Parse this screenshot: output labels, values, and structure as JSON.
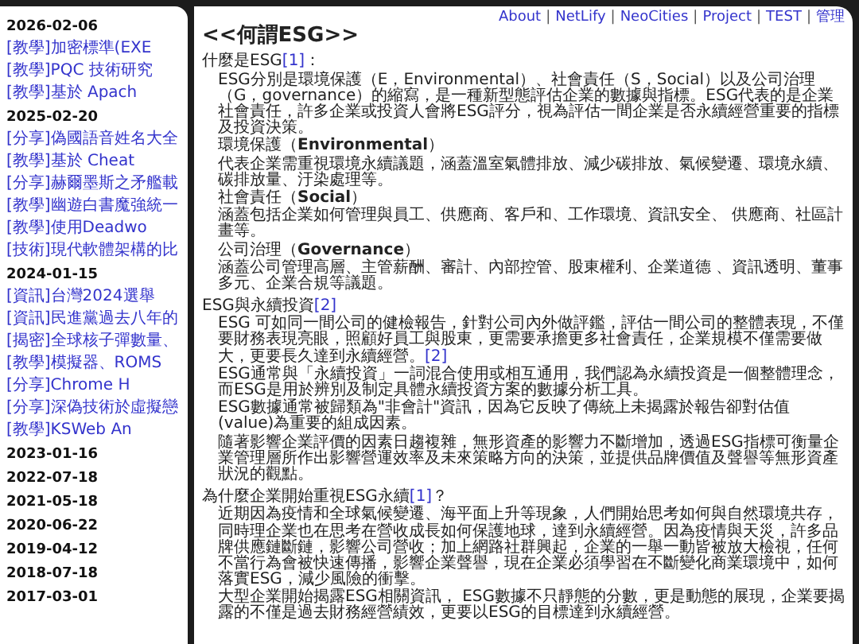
{
  "sidebar": {
    "groups": [
      {
        "date": "2026-02-06",
        "posts": [
          "[教學]加密標準(EXE",
          "[教學]PQC 技術研究",
          "[教學]基於 Apach"
        ]
      },
      {
        "date": "2025-02-20",
        "posts": [
          "[分享]偽國語音姓名大全",
          "[教學]基於 Cheat",
          "[分享]赫爾墨斯之矛艦載",
          "[教學]幽遊白書魔強統一",
          "[教學]使用Deadwo",
          "[技術]現代軟體架構的比"
        ]
      },
      {
        "date": "2024-01-15",
        "posts": [
          "[資訊]台灣2024選舉",
          "[資訊]民進黨過去八年的",
          "[揭密]全球核子彈數量、",
          "[教學]模擬器、ROMS",
          "[分享]Chrome H",
          "[分享]深偽技術於虛擬戀",
          "[教學]KSWeb An"
        ]
      },
      {
        "date": "2023-01-16"
      },
      {
        "date": "2022-07-18"
      },
      {
        "date": "2021-05-18"
      },
      {
        "date": "2020-06-22"
      },
      {
        "date": "2019-04-12"
      },
      {
        "date": "2018-07-18"
      },
      {
        "date": "2017-03-01"
      }
    ]
  },
  "nav": {
    "links": [
      "About",
      "NetLify",
      "NeoCities",
      "Project",
      "TEST",
      "管理"
    ],
    "separator": "|"
  },
  "title": "<<何謂ESG>>",
  "sections": [
    {
      "heading": "什麼是ESG",
      "ref": "[1]",
      "suffix": "：",
      "blocks": [
        {
          "kind": "paragraph",
          "text": "ESG分別是環境保護（E，Environmental）、社會責任（S，Social）以及公司治理（G，governance）的縮寫，是一種新型態評估企業的數據與指標。ESG代表的是企業社會責任，許多企業或投資人會將ESG評分，視為評估一間企業是否永續經營重要的指標及投資決策。"
        },
        {
          "kind": "subheading",
          "text": "環境保護（**Environmental**）"
        },
        {
          "kind": "paragraph",
          "text": "代表企業需重視環境永續議題，涵蓋溫室氣體排放、減少碳排放、氣候變遷、環境永續、碳排放量、汙染處理等。"
        },
        {
          "kind": "subheading",
          "text": "社會責任（**Social**）"
        },
        {
          "kind": "paragraph",
          "text": "涵蓋包括企業如何管理與員工、供應商、客戶和、工作環境、資訊安全、 供應商、社區計畫等。"
        },
        {
          "kind": "subheading",
          "text": "公司治理（**Governance**）"
        },
        {
          "kind": "paragraph",
          "text": "涵蓋公司管理高層、主管薪酬、審計、內部控管、股東權利、企業道德 、資訊透明、董事多元、企業合規等議題。"
        }
      ]
    },
    {
      "heading": "ESG與永續投資",
      "ref": "[2]",
      "blocks": [
        {
          "kind": "paragraph",
          "text": "ESG 可如同一間公司的健檢報告，針對公司內外做評鑑，評估一間公司的整體表現，不僅要財務表現亮眼，照顧好員工與股東，更需要承擔更多社會責任，企業規模不僅需要做大，更要長久達到永續經營。",
          "ref": "[2]"
        },
        {
          "kind": "paragraph",
          "text": "ESG通常與「永續投資」一詞混合使用或相互通用，我們認為永續投資是一個整體理念，而ESG是用於辨別及制定具體永續投資方案的數據分析工具。"
        },
        {
          "kind": "paragraph",
          "text": "ESG數據通常被歸類為\"非會計\"資訊，因為它反映了傳統上未揭露於報告卻對估值(value)為重要的組成因素。"
        },
        {
          "kind": "paragraph",
          "text": "隨著影響企業評價的因素日趨複雜，無形資產的影響力不斷增加，透過ESG指標可衡量企業管理層所作出影響營運效率及未來策略方向的決策，並提供品牌價值及聲譽等無形資產狀況的觀點。"
        }
      ]
    },
    {
      "heading": "為什麼企業開始重視ESG永續",
      "ref": "[1]",
      "suffix": "？",
      "blocks": [
        {
          "kind": "paragraph",
          "text": "近期因為疫情和全球氣候變遷、海平面上升等現象，人們開始思考如何與自然環境共存，同時理企業也在思考在營收成長如何保護地球，達到永續經營。因為疫情與天災，許多品牌供應鏈斷鏈，影響公司營收；加上網路社群興起，企業的一舉一動皆被放大檢視，任何不當行為會被快速傳播，影響企業聲譽，現在企業必須學習在不斷變化商業環境中，如何落實ESG，減少風險的衝擊。"
        },
        {
          "kind": "paragraph",
          "text": "大型企業開始揭露ESG相關資訊， ESG數據不只靜態的分數，更是動態的展現，企業要揭露的不僅是過去財務經營績效，更要以ESG的目標達到永續經營。"
        }
      ]
    }
  ]
}
